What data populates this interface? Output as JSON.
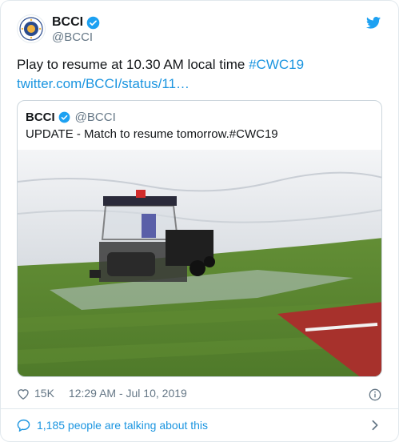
{
  "tweet": {
    "author_name": "BCCI",
    "author_handle": "@BCCI",
    "text_main": "Play to resume at 10.30 AM local time ",
    "text_hashtag": "#CWC19",
    "link": "twitter.com/BCCI/status/11…"
  },
  "quoted": {
    "author_name": "BCCI",
    "author_handle": "@BCCI",
    "text": "UPDATE - Match to resume tomorrow.#CWC19",
    "media_description": "covers machine mopping water on a cricket field"
  },
  "footer": {
    "likes": "15K",
    "timestamp": "12:29 AM - Jul 10, 2019",
    "talking": "1,185 people are talking about this"
  },
  "colors": {
    "link": "#1b95e0",
    "verified": "#1da1f2",
    "muted": "#657786",
    "border": "#e1e8ed"
  },
  "icons": [
    "verified-badge-icon",
    "twitter-bird-icon",
    "heart-icon",
    "info-icon",
    "comment-icon",
    "chevron-right-icon"
  ]
}
